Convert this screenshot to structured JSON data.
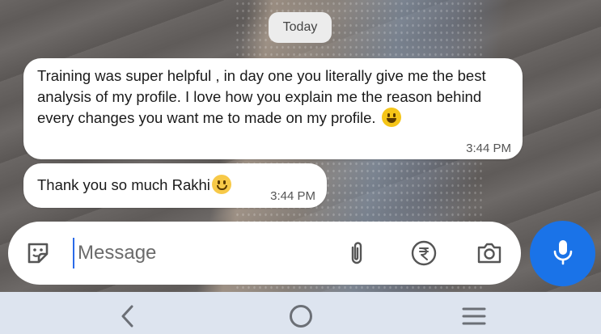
{
  "date_divider": "Today",
  "messages": [
    {
      "text": "Training was super helpful , in day one you literally give me the best analysis of my profile. I love how you explain me the reason behind every changes you want me to made on my profile.",
      "emoji": "grinning-face",
      "time": "3:44 PM"
    },
    {
      "text": "Thank you so much Rakhi",
      "emoji": "smiling-face-with-smiling-eyes",
      "time": "3:44 PM"
    }
  ],
  "composer": {
    "placeholder": "Message",
    "value": "",
    "icons": [
      "sticker-icon",
      "attachment-icon",
      "rupee-icon",
      "camera-icon",
      "microphone-icon"
    ]
  },
  "colors": {
    "accent": "#1a73e8",
    "bubble": "#ffffff",
    "navbar": "#dde4ef"
  },
  "navigation": {
    "icons": [
      "back-icon",
      "home-icon",
      "recent-apps-icon"
    ]
  }
}
